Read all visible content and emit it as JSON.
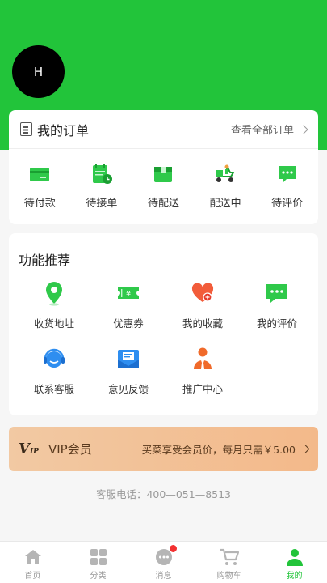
{
  "profile": {
    "avatar_initial": "H"
  },
  "orders": {
    "title": "我的订单",
    "view_all": "查看全部订单",
    "items": [
      {
        "label": "待付款",
        "icon": "wallet-icon"
      },
      {
        "label": "待接单",
        "icon": "calendar-clock-icon"
      },
      {
        "label": "待配送",
        "icon": "package-icon"
      },
      {
        "label": "配送中",
        "icon": "delivery-scooter-icon"
      },
      {
        "label": "待评价",
        "icon": "chat-bubble-icon"
      }
    ]
  },
  "features": {
    "title": "功能推荐",
    "items": [
      {
        "label": "收货地址",
        "icon": "location-pin-icon"
      },
      {
        "label": "优惠券",
        "icon": "coupon-icon"
      },
      {
        "label": "我的收藏",
        "icon": "heart-icon"
      },
      {
        "label": "我的评价",
        "icon": "comment-icon"
      },
      {
        "label": "联系客服",
        "icon": "headset-icon"
      },
      {
        "label": "意见反馈",
        "icon": "feedback-mail-icon"
      },
      {
        "label": "推广中心",
        "icon": "agent-person-icon"
      }
    ]
  },
  "vip": {
    "logo_main": "V",
    "logo_sub": "IP",
    "title": "VIP会员",
    "desc": "买菜享受会员价，每月只需￥5.00"
  },
  "hotline": "客服电话：400—051—8513",
  "tabbar": [
    {
      "label": "首页",
      "icon": "home-icon",
      "active": false
    },
    {
      "label": "分类",
      "icon": "grid-icon",
      "active": false
    },
    {
      "label": "消息",
      "icon": "message-icon",
      "active": false,
      "badge": true
    },
    {
      "label": "购物车",
      "icon": "cart-icon",
      "active": false
    },
    {
      "label": "我的",
      "icon": "user-icon",
      "active": true
    }
  ],
  "colors": {
    "brand": "#22c43a",
    "badge": "#f23030",
    "vip_bg": "#f3c29a"
  }
}
